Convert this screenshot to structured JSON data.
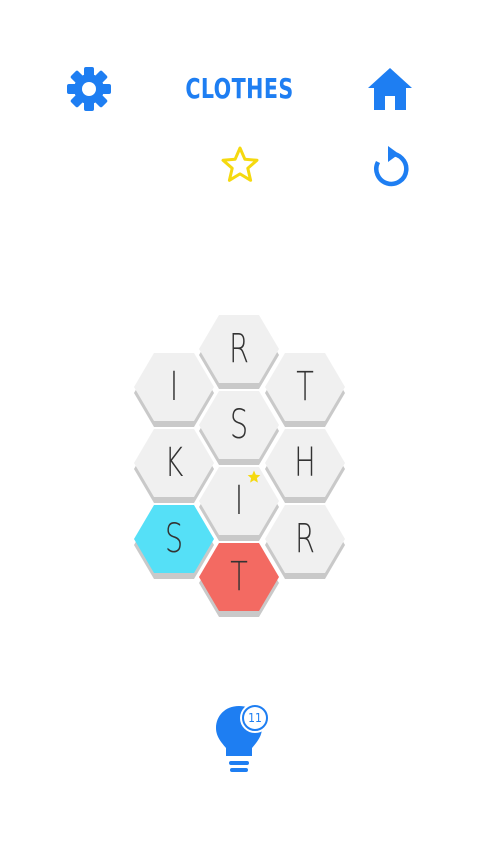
{
  "header": {
    "title": "CLOTHES",
    "settings_icon": "gear-icon",
    "home_icon": "home-icon",
    "star_icon": "star-outline-icon",
    "restart_icon": "restart-icon"
  },
  "board": {
    "tiles": [
      {
        "letter": "R",
        "state": "normal"
      },
      {
        "letter": "I",
        "state": "normal"
      },
      {
        "letter": "T",
        "state": "normal"
      },
      {
        "letter": "S",
        "state": "normal"
      },
      {
        "letter": "K",
        "state": "normal"
      },
      {
        "letter": "H",
        "state": "normal"
      },
      {
        "letter": "I",
        "state": "normal"
      },
      {
        "letter": "S",
        "state": "selected-blue"
      },
      {
        "letter": "R",
        "state": "normal"
      },
      {
        "letter": "T",
        "state": "selected-red"
      }
    ]
  },
  "hint": {
    "icon": "lightbulb-icon",
    "count": "11"
  },
  "colors": {
    "accent": "#1e7ef2",
    "star": "#f5d90f",
    "tile": "#f0f0f0",
    "tile_shadow": "#c9c9c9",
    "blue_tile": "#55e0f7",
    "red_tile": "#f36a62"
  }
}
